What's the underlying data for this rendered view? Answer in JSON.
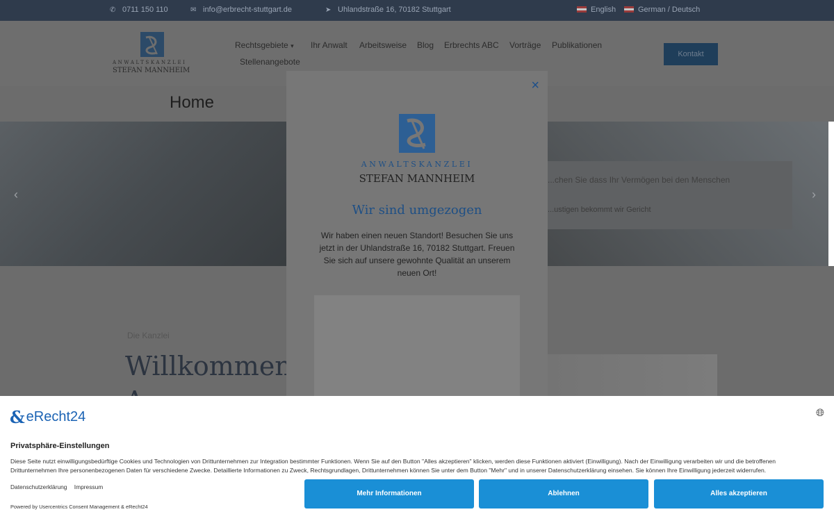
{
  "topbar": {
    "phone": "0711 150 110",
    "email": "info@erbrecht-stuttgart.de",
    "address": "Uhlandstraße 16, 70182 Stuttgart",
    "lang_en": "English",
    "lang_de": "German / Deutsch"
  },
  "header": {
    "logo_line1": "ANWALTSKANZLEI",
    "logo_line2": "STEFAN MANNHEIM",
    "nav": {
      "rechtsgebiete": "Rechtsgebiete",
      "ihr_anwalt": "Ihr Anwalt",
      "arbeitsweise": "Arbeitsweise",
      "blog": "Blog",
      "erbrechts_abc": "Erbrechts ABC",
      "vortraege": "Vorträge",
      "publikationen": "Publikationen",
      "stellenangebote": "Stellenangebote"
    },
    "kontakt_button": "Kontakt"
  },
  "page": {
    "title": "Home",
    "hero_text": "...chen Sie dass Ihr Vermögen bei den Menschen",
    "hero_subtext": "...ustigen bekommt wir Gericht"
  },
  "content": {
    "eyebrow": "Die Kanzlei",
    "heading_line1": "Willkommen b",
    "heading_line2": "A"
  },
  "modal": {
    "close": "×",
    "logo_line1": "ANWALTSKANZLEI",
    "logo_line2": "STEFAN MANNHEIM",
    "title": "Wir sind umgezogen",
    "text": "Wir haben einen neuen Standort! Besuchen Sie uns jetzt in der Uhlandstraße 16, 70182 Stuttgart. Freuen Sie sich auf unsere gewohnte Qualität an unserem neuen Ort!"
  },
  "consent": {
    "brand": "eRecht24",
    "title": "Privatsphäre-Einstellungen",
    "text": "Diese Seite nutzt einwilligungsbedürftige Cookies und Technologien von Drittunternehmen zur Integration bestimmter Funktionen. Wenn Sie auf den Button \"Alles akzeptieren\" klicken, werden diese Funktionen aktiviert (Einwilligung). Nach der Einwilligung verarbeiten wir und die betroffenen Drittunternehmen Ihre personenbezogenen Daten für verschiedene Zwecke. Detaillierte Informationen zu Zweck, Rechtsgrundlagen, Drittunternehmen können Sie unter dem Button \"Mehr\" und in unserer Datenschutzerklärung einsehen. Sie können Ihre Einwilligung jederzeit widerrufen.",
    "link_privacy": "Datenschutzerklärung",
    "link_imprint": "Impressum",
    "powered": "Powered by Usercentrics Consent Management & eRecht24",
    "btn_more": "Mehr Informationen",
    "btn_decline": "Ablehnen",
    "btn_accept": "Alles akzeptieren"
  },
  "colors": {
    "brand_blue": "#1e4f85",
    "consent_button": "#1a8fd6",
    "topbar": "#2f3b4c",
    "kontakt_button": "#1f3e5a"
  }
}
